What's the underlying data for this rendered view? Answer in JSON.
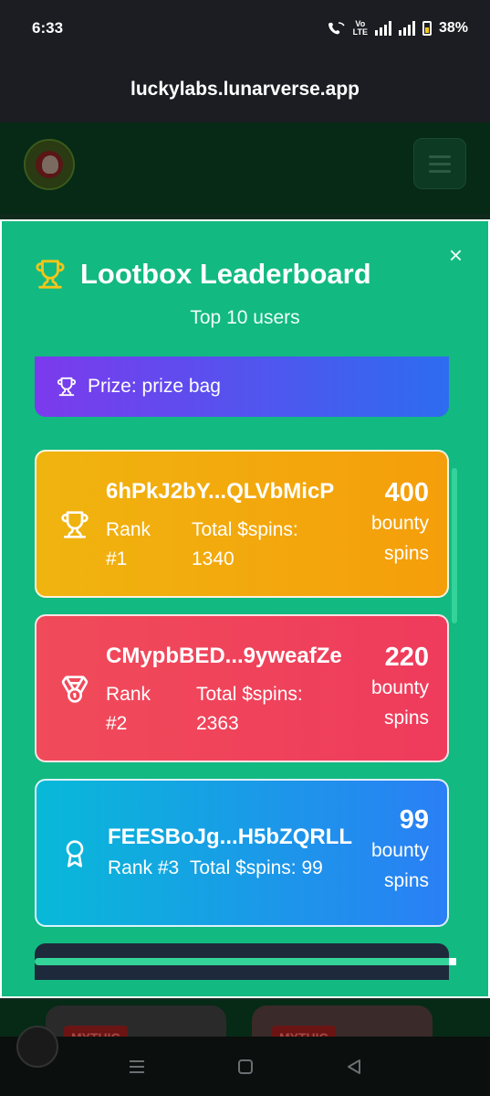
{
  "status": {
    "time": "6:33",
    "network_top": "Vo",
    "network_bottom": "LTE",
    "battery": "38%"
  },
  "browser": {
    "url": "luckylabs.lunarverse.app"
  },
  "modal": {
    "title": "Lootbox Leaderboard",
    "subtitle": "Top 10 users",
    "close_label": "×",
    "prize": "Prize: prize bag",
    "entries": [
      {
        "address": "6hPkJ2bY...QLVbMicP",
        "rank": "Rank #1",
        "total": "Total $spins: 1340",
        "bounty": "400",
        "bounty_label": "bounty spins"
      },
      {
        "address": "CMypbBED...9yweafZe",
        "rank": "Rank #2",
        "total": "Total $spins: 2363",
        "bounty": "220",
        "bounty_label": "bounty spins"
      },
      {
        "address": "FEESBoJg...H5bZQRLL",
        "rank": "Rank #3",
        "total": "Total $spins: 99",
        "bounty": "99",
        "bounty_label": "bounty spins"
      }
    ]
  },
  "background": {
    "tag_1": "MYTHIC",
    "tag_2": "MYTHIC"
  },
  "colors": {
    "modal_bg": "#12b981",
    "gold": "#f0b40f",
    "red": "#f04b5a",
    "blue": "#2a7ff5",
    "trophy": "#f5c518"
  }
}
